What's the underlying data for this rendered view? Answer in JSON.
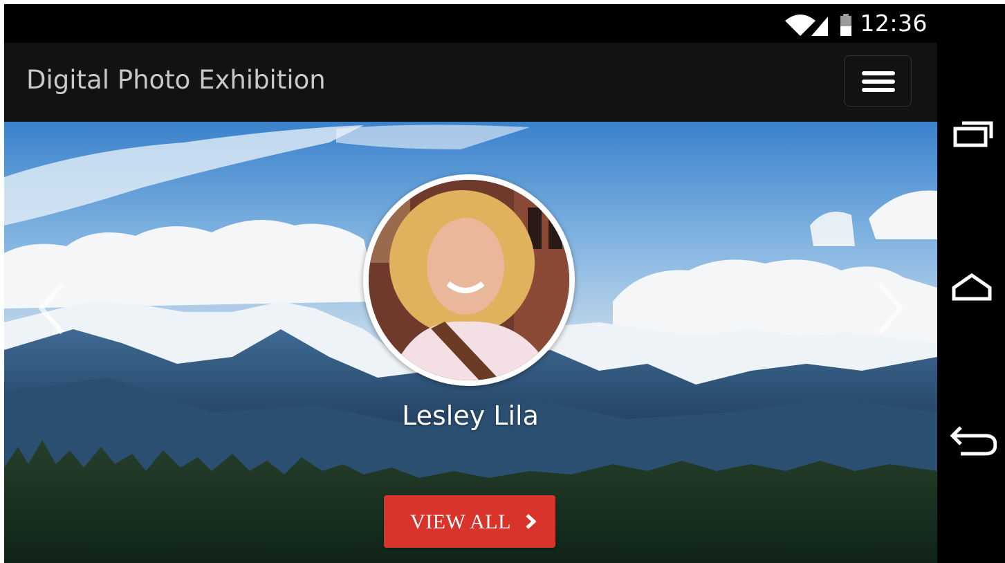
{
  "status_bar": {
    "time": "12:36",
    "icons": [
      "wifi-icon",
      "signal-icon",
      "battery-icon"
    ]
  },
  "app_bar": {
    "title": "Digital Photo Exhibition",
    "menu_icon": "hamburger-menu-icon"
  },
  "hero": {
    "background": "mountain-landscape-photo",
    "prev_icon": "chevron-left-icon",
    "next_icon": "chevron-right-icon",
    "avatar": "profile-photo",
    "name": "Lesley Lila",
    "button_label": "VIEW ALL",
    "button_icon": "chevron-right-icon"
  },
  "nav_bar": {
    "recents_icon": "recent-apps-icon",
    "home_icon": "home-icon",
    "back_icon": "back-icon"
  },
  "colors": {
    "accent": "#d9342b",
    "app_bar": "#121212",
    "app_title": "#c9c9c9"
  }
}
